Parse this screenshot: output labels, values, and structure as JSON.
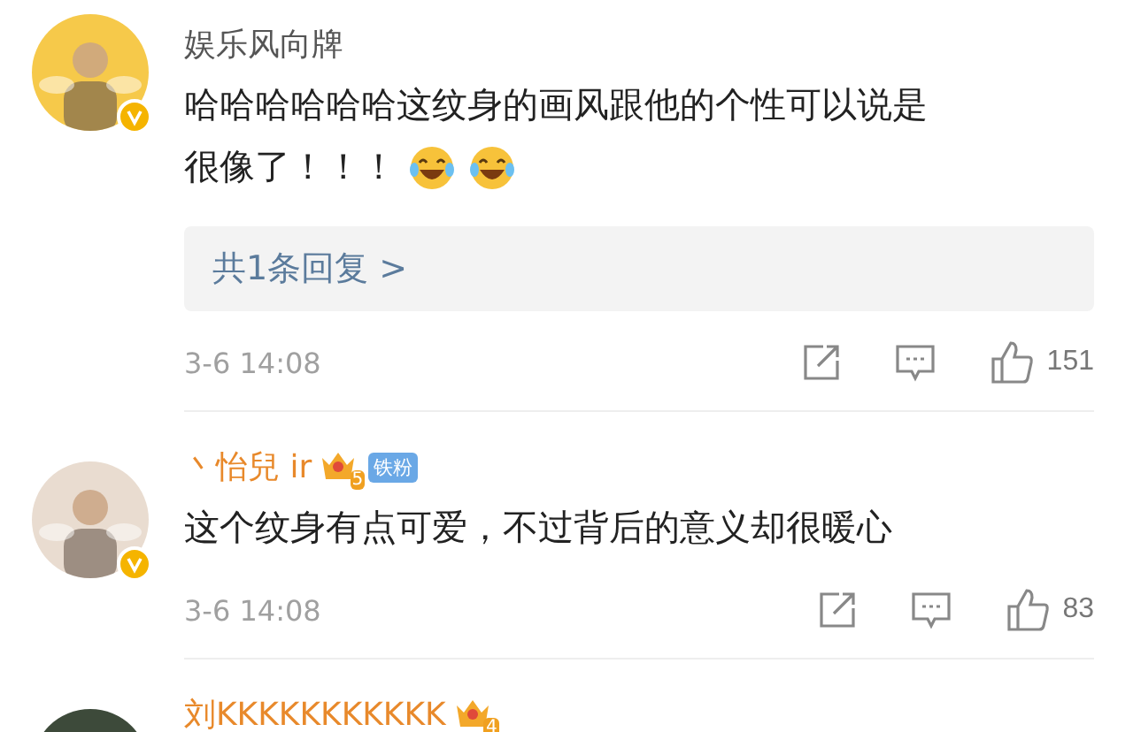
{
  "comments": [
    {
      "name": "娱乐风向牌",
      "vip": false,
      "verified": true,
      "text_parts": [
        {
          "kind": "text",
          "text": "哈哈哈哈哈哈这纹身的画风跟他的个性可以说是"
        },
        {
          "kind": "text",
          "text": "很像了！！！"
        },
        {
          "kind": "emoji"
        },
        {
          "kind": "emoji"
        }
      ],
      "reply": "共1条回复 >",
      "date": "3-6 14:08",
      "likes": "151"
    },
    {
      "name": "丶怡兒 ir",
      "vip": true,
      "crown": "5",
      "badge": "铁粉",
      "verified": true,
      "text_parts": [
        {
          "kind": "text",
          "text": "这个纹身有点可爱，不过背后的意义却很暖心"
        }
      ],
      "date": "3-6 14:08",
      "likes": "83"
    },
    {
      "name": "刘KKKKKKKKKKK",
      "vip": true,
      "crown": "4"
    }
  ]
}
